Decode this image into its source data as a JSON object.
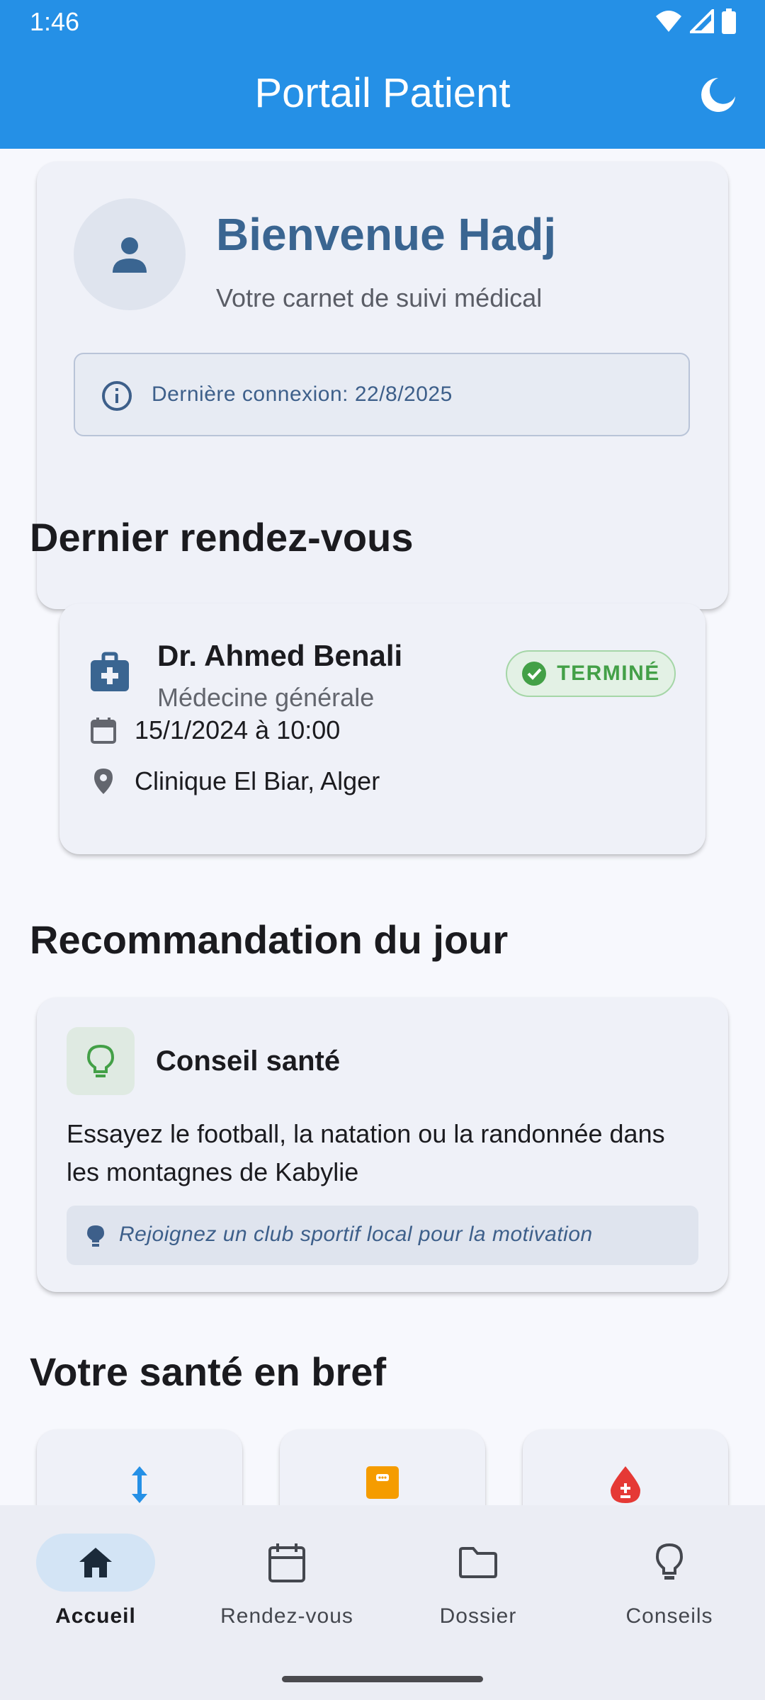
{
  "status": {
    "time": "1:46"
  },
  "appbar": {
    "title": "Portail Patient",
    "theme_icon": "moon-icon"
  },
  "welcome": {
    "title": "Bienvenue Hadj",
    "subtitle": "Votre carnet de suivi médical",
    "last_login": "Dernière connexion: 22/8/2025"
  },
  "sections": {
    "appointment": "Dernier rendez-vous",
    "recommendation": "Recommandation du jour",
    "health": "Votre santé en bref"
  },
  "appointment": {
    "doctor": "Dr. Ahmed Benali",
    "specialty": "Médecine générale",
    "status": "TERMINÉ",
    "datetime": "15/1/2024 à 10:00",
    "location": "Clinique El Biar, Alger"
  },
  "tip": {
    "title": "Conseil santé",
    "body": "Essayez le football, la natation ou la randonnée dans les montagnes de Kabylie",
    "note": "Rejoignez un club sportif local pour la motivation"
  },
  "health_stats": [
    {
      "icon": "height-arrows-icon",
      "color": "#2590e6"
    },
    {
      "icon": "weight-note-icon",
      "color": "#f59c00"
    },
    {
      "icon": "blood-type-icon",
      "color": "#e53935"
    }
  ],
  "nav": {
    "items": [
      {
        "label": "Accueil",
        "icon": "home-icon",
        "active": true
      },
      {
        "label": "Rendez-vous",
        "icon": "calendar-icon",
        "active": false
      },
      {
        "label": "Dossier",
        "icon": "folder-icon",
        "active": false
      },
      {
        "label": "Conseils",
        "icon": "lightbulb-icon",
        "active": false
      }
    ]
  },
  "colors": {
    "primary": "#2590e6",
    "title_blue": "#3a6591",
    "success": "#43a047"
  }
}
